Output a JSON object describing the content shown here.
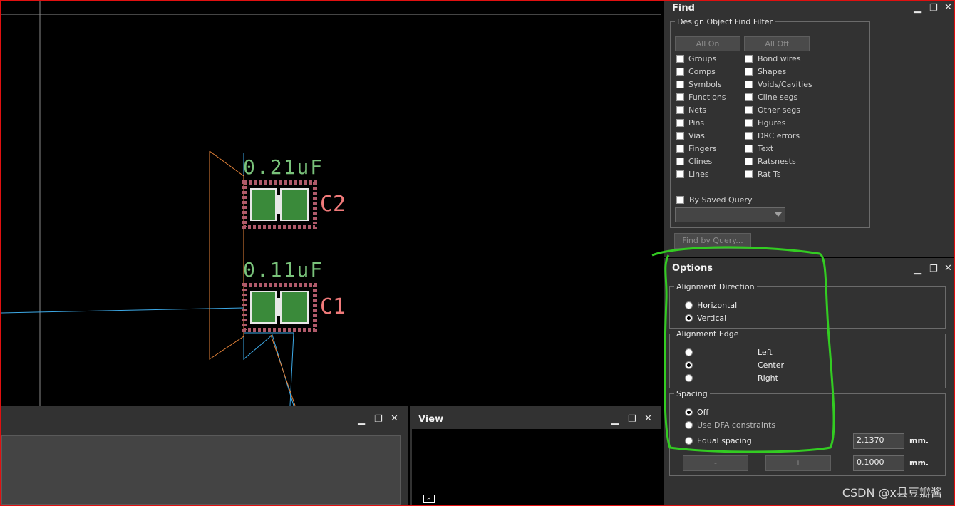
{
  "canvas": {
    "components": [
      {
        "value": "0.21uF",
        "ref": "C2"
      },
      {
        "value": "0.11uF",
        "ref": "C1"
      }
    ]
  },
  "find_panel": {
    "title": "Find",
    "filter_group": "Design Object Find Filter",
    "all_on": "All On",
    "all_off": "All Off",
    "left_items": [
      "Groups",
      "Comps",
      "Symbols",
      "Functions",
      "Nets",
      "Pins",
      "Vias",
      "Fingers",
      "Clines",
      "Lines"
    ],
    "right_items": [
      "Bond wires",
      "Shapes",
      "Voids/Cavities",
      "Cline segs",
      "Other segs",
      "Figures",
      "DRC errors",
      "Text",
      "Ratsnests",
      "Rat Ts"
    ],
    "saved_query_label": "By Saved Query",
    "saved_query_value": "",
    "find_by_query": "Find by Query..."
  },
  "options_panel": {
    "title": "Options",
    "alignment_direction": {
      "label": "Alignment Direction",
      "options": [
        {
          "label": "Horizontal",
          "selected": false
        },
        {
          "label": "Vertical",
          "selected": true
        }
      ]
    },
    "alignment_edge": {
      "label": "Alignment Edge",
      "options": [
        {
          "label": "Left",
          "selected": false
        },
        {
          "label": "Center",
          "selected": true
        },
        {
          "label": "Right",
          "selected": false
        }
      ]
    },
    "spacing": {
      "label": "Spacing",
      "off": "Off",
      "use_dfa": "Use DFA constraints",
      "equal": "Equal spacing",
      "selected": "Off",
      "equal_value": "2.1370",
      "increment_value": "0.1000",
      "unit": "mm.",
      "minus": "-",
      "plus": "+"
    }
  },
  "bottom_left_panel": {
    "title": ""
  },
  "view_panel": {
    "title": "View",
    "tag": "a"
  },
  "watermark": "CSDN @x县豆瓣酱",
  "colors": {
    "highlight": "#33cc22",
    "frame": "#e01010"
  }
}
